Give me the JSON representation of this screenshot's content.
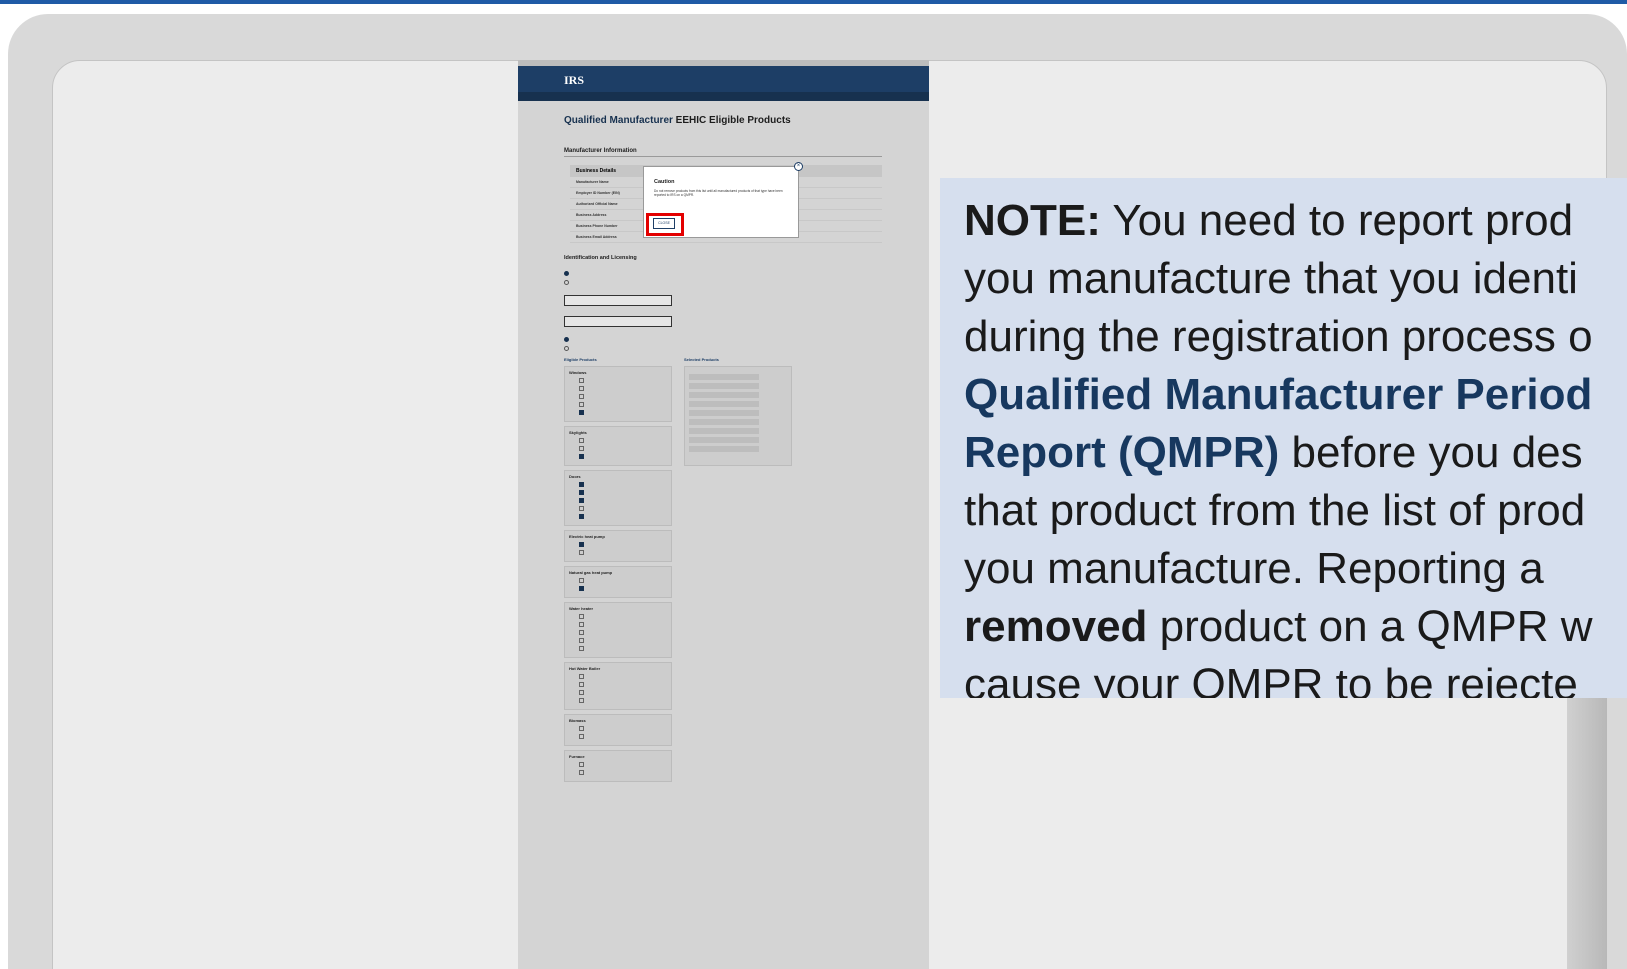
{
  "slide": {
    "note": {
      "lines": [
        {
          "parts": [
            {
              "t": "NOTE:",
              "s": "b"
            },
            {
              "t": " You need to report prod",
              "s": ""
            }
          ]
        },
        {
          "parts": [
            {
              "t": "you manufacture that you identi",
              "s": ""
            }
          ]
        },
        {
          "parts": [
            {
              "t": "during the registration process o",
              "s": ""
            }
          ]
        },
        {
          "parts": [
            {
              "t": "Qualified Manufacturer Period",
              "s": "navy"
            }
          ]
        },
        {
          "parts": [
            {
              "t": "Report (QMPR)",
              "s": "navy"
            },
            {
              "t": " before you des",
              "s": ""
            }
          ]
        },
        {
          "parts": [
            {
              "t": "that product from the list of prod",
              "s": ""
            }
          ]
        },
        {
          "parts": [
            {
              "t": "you manufacture. Reporting a",
              "s": ""
            }
          ]
        },
        {
          "parts": [
            {
              "t": "removed",
              "s": "b"
            },
            {
              "t": " product on a QMPR w",
              "s": ""
            }
          ]
        },
        {
          "parts": [
            {
              "t": "cause your QMPR to be rejecte",
              "s": ""
            }
          ]
        }
      ]
    }
  },
  "screenshot": {
    "logo": "IRS",
    "page_title_bold": "Qualified Manufacturer",
    "page_title_rest": " EEHIC Eligible Products",
    "section_title": "Manufacturer Information",
    "table_header": "Business Details",
    "rows": [
      "Manufacturer Name",
      "Employer ID Number (EIN)",
      "Authorized Official Name",
      "Business Address",
      "Business Phone Number",
      "Business Email Address"
    ],
    "id_section": "Identification and Licensing",
    "eligible_header": "Eligible Products",
    "selected_header": "Selected Products",
    "groups": [
      {
        "title": "Windows",
        "items": [
          false,
          false,
          false,
          false,
          true
        ]
      },
      {
        "title": "Skylights",
        "items": [
          false,
          false,
          true
        ]
      },
      {
        "title": "Doors",
        "items": [
          true,
          true,
          true,
          false,
          true
        ]
      },
      {
        "title": "Electric heat pump",
        "items": [
          true,
          false
        ]
      },
      {
        "title": "Natural gas heat pump",
        "items": [
          false,
          true
        ]
      },
      {
        "title": "Water heater",
        "items": [
          false,
          false,
          false,
          false,
          false
        ]
      },
      {
        "title": "Hot Water Boiler",
        "items": [
          false,
          false,
          false,
          false
        ]
      },
      {
        "title": "Biomass",
        "items": [
          false,
          false
        ]
      },
      {
        "title": "Furnace",
        "items": [
          false,
          false
        ]
      }
    ],
    "selected_count": 9,
    "dialog": {
      "title": "Caution",
      "message": "Do not remove products from this list until all manufactured products of that type have been reported to IRS on a QMPR.",
      "close_label": "CLOSE"
    },
    "colors": {
      "header": "#1d3e66",
      "highlight": "#e30000"
    }
  }
}
